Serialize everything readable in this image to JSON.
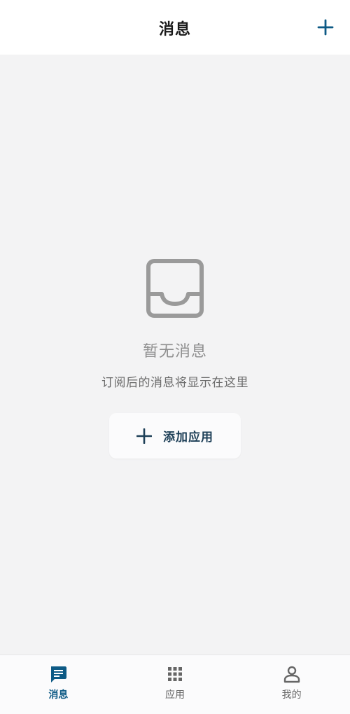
{
  "header": {
    "title": "消息"
  },
  "empty_state": {
    "title": "暂无消息",
    "subtitle": "订阅后的消息将显示在这里",
    "add_button_label": "添加应用"
  },
  "bottom_nav": {
    "items": [
      {
        "label": "消息",
        "icon": "message-icon",
        "active": true
      },
      {
        "label": "应用",
        "icon": "grid-icon",
        "active": false
      },
      {
        "label": "我的",
        "icon": "person-icon",
        "active": false
      }
    ]
  },
  "colors": {
    "accent": "#0d5a85",
    "background": "#f3f3f4",
    "header_bg": "#ffffff",
    "muted_icon": "#9a9a9a"
  }
}
